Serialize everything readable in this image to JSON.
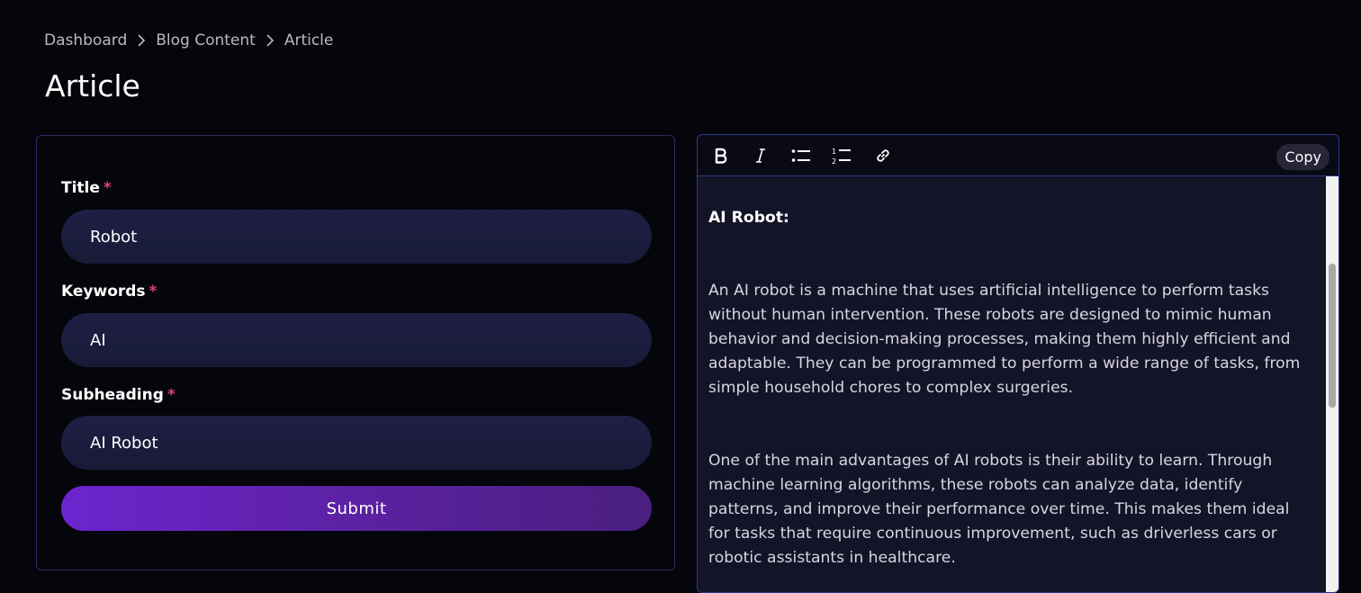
{
  "breadcrumb": {
    "items": [
      "Dashboard",
      "Blog Content",
      "Article"
    ]
  },
  "page": {
    "title": "Article"
  },
  "form": {
    "fields": [
      {
        "label": "Title",
        "required_mark": "*",
        "value": "Robot"
      },
      {
        "label": "Keywords",
        "required_mark": "*",
        "value": "AI"
      },
      {
        "label": "Subheading",
        "required_mark": "*",
        "value": "AI Robot"
      }
    ],
    "submit_label": "Submit"
  },
  "editor": {
    "toolbar": {
      "tools": [
        "bold-icon",
        "italic-icon",
        "bullet-list-icon",
        "numbered-list-icon",
        "link-icon"
      ],
      "copy_label": "Copy"
    },
    "heading": "AI Robot:",
    "paragraphs": [
      "An AI robot is a machine that uses artificial intelligence to perform tasks without human intervention. These robots are designed to mimic human behavior and decision-making processes, making them highly efficient and adaptable. They can be programmed to perform a wide range of tasks, from simple household chores to complex surgeries.",
      "One of the main advantages of AI robots is their ability to learn. Through machine learning algorithms, these robots can analyze data, identify patterns, and improve their performance over time. This makes them ideal for tasks that require continuous improvement, such as driverless cars or robotic assistants in healthcare."
    ]
  },
  "colors": {
    "background": "#05050b",
    "accent": "#6d24cf",
    "required": "#e0407a",
    "input_bg": "#1e1f45",
    "editor_border": "#2a3a8c"
  }
}
